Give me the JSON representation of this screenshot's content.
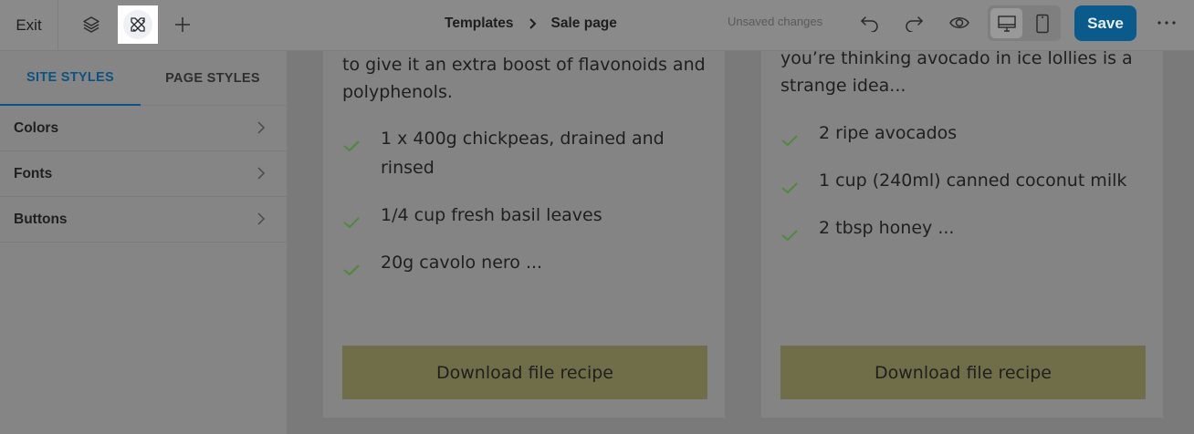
{
  "toolbar": {
    "exit_label": "Exit",
    "breadcrumb": [
      "Templates",
      "Sale page"
    ],
    "status": "Unsaved changes",
    "save_label": "Save",
    "icons": {
      "layers": "layers-icon",
      "site_styles": "styles-brush-icon",
      "add": "plus-icon",
      "undo": "undo-icon",
      "redo": "redo-icon",
      "preview": "eye-icon",
      "desktop": "desktop-icon",
      "mobile": "mobile-icon",
      "more": "more-horizontal-icon"
    },
    "save_color": "#0a5b8c"
  },
  "sidebar": {
    "tabs": [
      {
        "label": "SITE STYLES",
        "active": true
      },
      {
        "label": "PAGE STYLES",
        "active": false
      }
    ],
    "rows": [
      {
        "label": "Colors"
      },
      {
        "label": "Fonts"
      },
      {
        "label": "Buttons"
      }
    ]
  },
  "canvas": {
    "cards": [
      {
        "description": [
          "to give it an extra boost of flavonoids and",
          "polyphenols."
        ],
        "ingredients": [
          [
            "1 x 400g chickpeas, drained and",
            "rinsed"
          ],
          [
            "1/4 cup fresh basil leaves"
          ],
          [
            "20g cavolo nero ..."
          ]
        ],
        "button": "Download file recipe"
      },
      {
        "description": [
          "you’re thinking avocado in ice lollies is a",
          "strange idea..."
        ],
        "ingredients": [
          [
            "2 ripe avocados"
          ],
          [
            "1 cup (240ml) canned coconut milk"
          ],
          [
            "2 tbsp honey ..."
          ]
        ],
        "button": "Download file recipe"
      }
    ],
    "check_color": "#4f8a3a",
    "button_color": "#6f6e49"
  }
}
